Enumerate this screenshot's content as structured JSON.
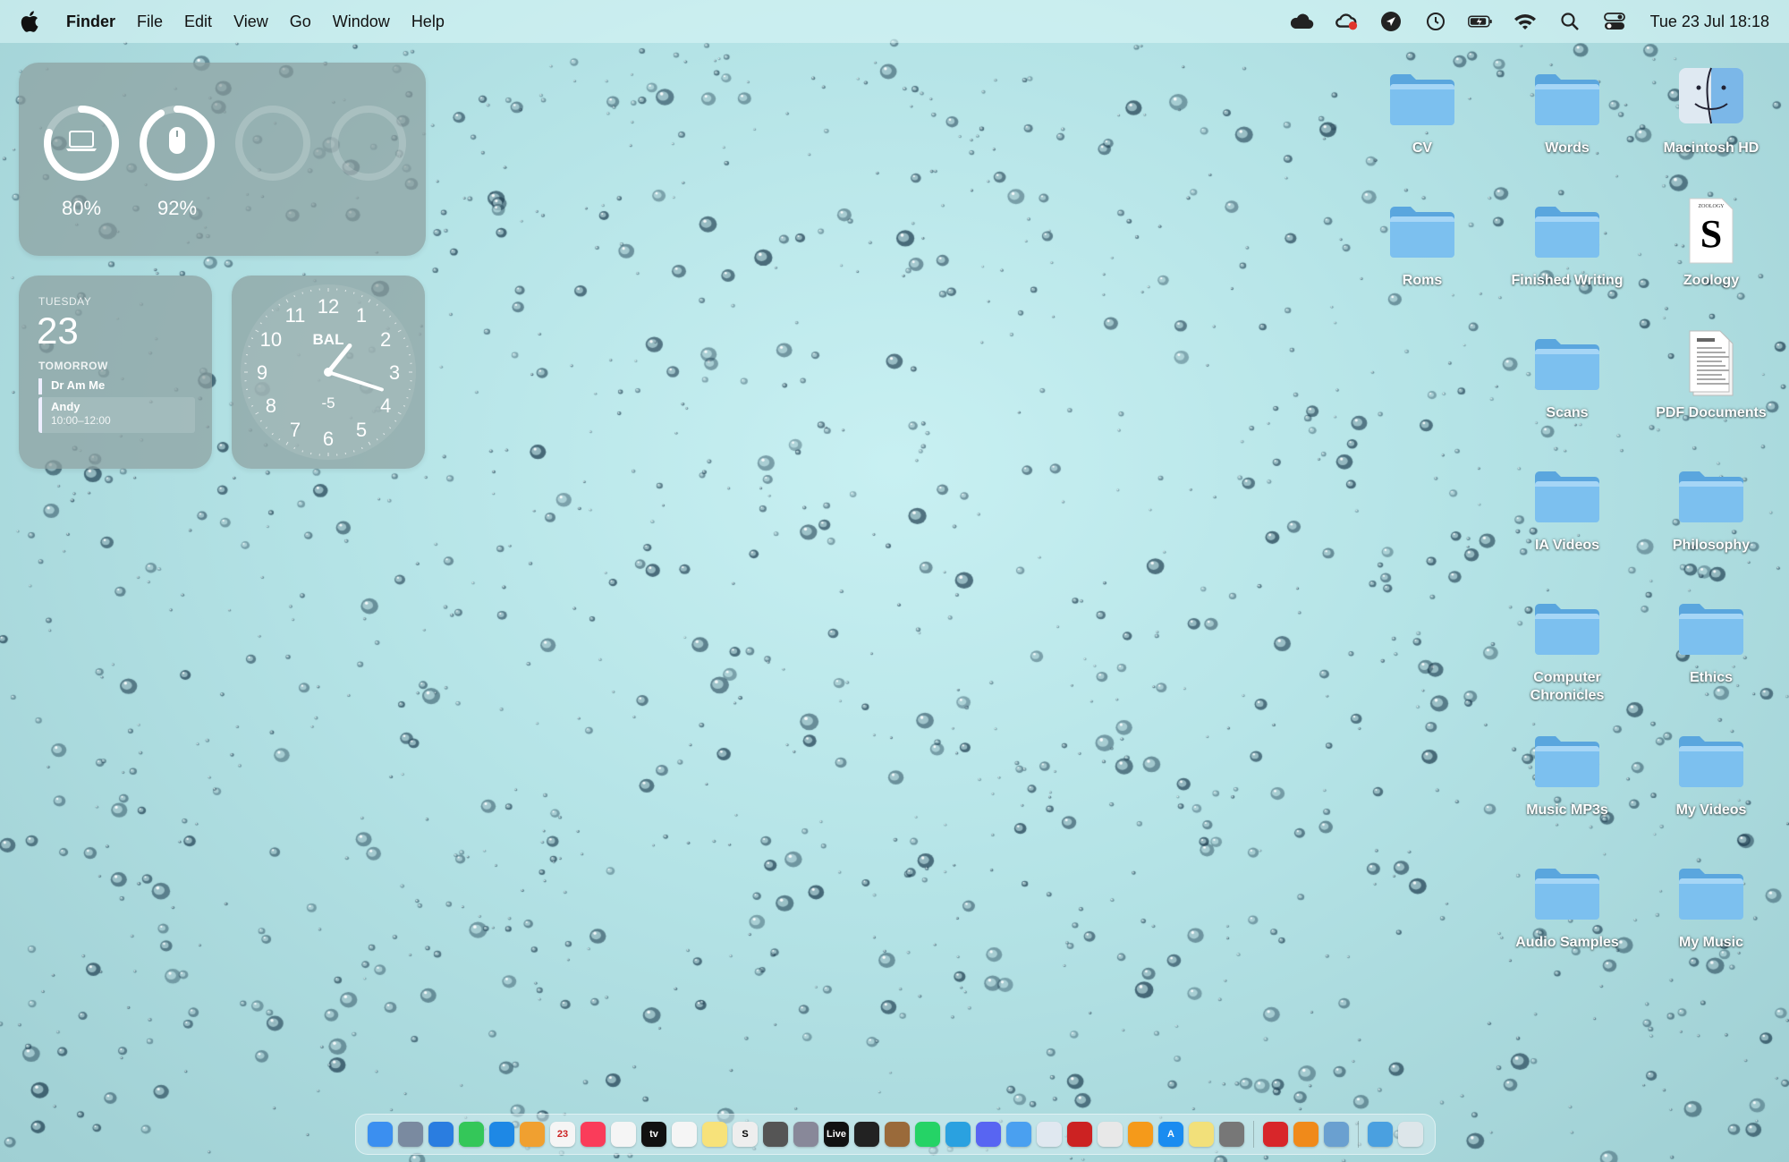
{
  "menubar": {
    "app_name": "Finder",
    "items": [
      "File",
      "Edit",
      "View",
      "Go",
      "Window",
      "Help"
    ],
    "status_icons": [
      "cloud-icon",
      "creative-cloud-icon",
      "location-arrow-icon",
      "time-machine-icon",
      "battery-icon",
      "wifi-icon",
      "spotlight-search-icon",
      "control-center-icon"
    ],
    "datetime": "Tue 23 Jul  18:18"
  },
  "battery_widget": {
    "devices": [
      {
        "device": "laptop-icon",
        "percent_label": "80%",
        "level": 0.8
      },
      {
        "device": "mouse-icon",
        "percent_label": "92%",
        "level": 0.92
      },
      {
        "device": "empty",
        "percent_label": "",
        "level": 0
      },
      {
        "device": "empty",
        "percent_label": "",
        "level": 0
      }
    ]
  },
  "calendar_widget": {
    "weekday": "TUESDAY",
    "date": "23",
    "section": "TOMORROW",
    "events": [
      {
        "title": "Dr Am Me",
        "time": ""
      },
      {
        "title": "Andy",
        "time": "10:00–12:00"
      }
    ]
  },
  "clock_widget": {
    "city": "BAL",
    "offset": "-5",
    "numbers": [
      "12",
      "1",
      "2",
      "3",
      "4",
      "5",
      "6",
      "7",
      "8",
      "9",
      "10",
      "11"
    ],
    "hour": 1,
    "minute": 18
  },
  "desktop_icons": [
    {
      "label": "CV",
      "type": "folder"
    },
    {
      "label": "Words",
      "type": "folder"
    },
    {
      "label": "Macintosh HD",
      "type": "drive"
    },
    {
      "label": "Roms",
      "type": "folder"
    },
    {
      "label": "Finished Writing",
      "type": "folder"
    },
    {
      "label": "Zoology",
      "type": "document"
    },
    {
      "label": "Scans",
      "type": "folder"
    },
    {
      "label": "PDF Documents",
      "type": "pdf"
    },
    {
      "label": "IA Videos",
      "type": "folder"
    },
    {
      "label": "Philosophy",
      "type": "folder"
    },
    {
      "label": "Computer Chronicles",
      "type": "folder"
    },
    {
      "label": "Ethics",
      "type": "folder"
    },
    {
      "label": "Music MP3s",
      "type": "folder"
    },
    {
      "label": "My Videos",
      "type": "folder"
    },
    {
      "label": "Audio Samples",
      "type": "folder"
    },
    {
      "label": "My Music",
      "type": "folder"
    }
  ],
  "dock": {
    "apps": [
      {
        "name": "finder",
        "color": "#3b8ff0",
        "glyph": ""
      },
      {
        "name": "launchpad",
        "color": "#7a8aa0",
        "glyph": ""
      },
      {
        "name": "safari",
        "color": "#2a7de0",
        "glyph": ""
      },
      {
        "name": "messages",
        "color": "#34c759",
        "glyph": ""
      },
      {
        "name": "mail",
        "color": "#1e88e5",
        "glyph": ""
      },
      {
        "name": "photos",
        "color": "#f0a030",
        "glyph": ""
      },
      {
        "name": "calendar",
        "color": "#f5f5f5",
        "glyph": "23"
      },
      {
        "name": "music",
        "color": "#fa3c5a",
        "glyph": ""
      },
      {
        "name": "reminders",
        "color": "#f5f5f5",
        "glyph": ""
      },
      {
        "name": "apple-tv",
        "color": "#111111",
        "glyph": "tv"
      },
      {
        "name": "clock",
        "color": "#f5f5f5",
        "glyph": ""
      },
      {
        "name": "notes",
        "color": "#f7e27a",
        "glyph": ""
      },
      {
        "name": "scrivener",
        "color": "#eeeeee",
        "glyph": "S"
      },
      {
        "name": "disk-utility",
        "color": "#555555",
        "glyph": ""
      },
      {
        "name": "image-capture",
        "color": "#888899",
        "glyph": ""
      },
      {
        "name": "live",
        "color": "#111111",
        "glyph": "Live"
      },
      {
        "name": "audio-editor",
        "color": "#222222",
        "glyph": ""
      },
      {
        "name": "books-brown",
        "color": "#9a6a3a",
        "glyph": ""
      },
      {
        "name": "whatsapp",
        "color": "#25d366",
        "glyph": ""
      },
      {
        "name": "telegram",
        "color": "#2aa1e0",
        "glyph": ""
      },
      {
        "name": "discord",
        "color": "#5865f2",
        "glyph": ""
      },
      {
        "name": "icloud-drive",
        "color": "#4aa0f0",
        "glyph": ""
      },
      {
        "name": "vpn",
        "color": "#e0e8f0",
        "glyph": ""
      },
      {
        "name": "game",
        "color": "#cc2222",
        "glyph": ""
      },
      {
        "name": "chrome",
        "color": "#e8e8e8",
        "glyph": ""
      },
      {
        "name": "pages",
        "color": "#f59a1a",
        "glyph": ""
      },
      {
        "name": "app-store",
        "color": "#1a8cf0",
        "glyph": "A"
      },
      {
        "name": "stickies",
        "color": "#f2e07a",
        "glyph": ""
      },
      {
        "name": "system-settings",
        "color": "#777777",
        "glyph": ""
      }
    ],
    "apps_right": [
      {
        "name": "acrobat",
        "color": "#d8262a",
        "glyph": ""
      },
      {
        "name": "books",
        "color": "#f08a1a",
        "glyph": ""
      },
      {
        "name": "preview",
        "color": "#6aa0d0",
        "glyph": ""
      }
    ],
    "trash_area": [
      {
        "name": "downloads-folder",
        "color": "#4aa0e0",
        "glyph": ""
      },
      {
        "name": "trash",
        "color": "#dde6ea",
        "glyph": ""
      }
    ]
  }
}
